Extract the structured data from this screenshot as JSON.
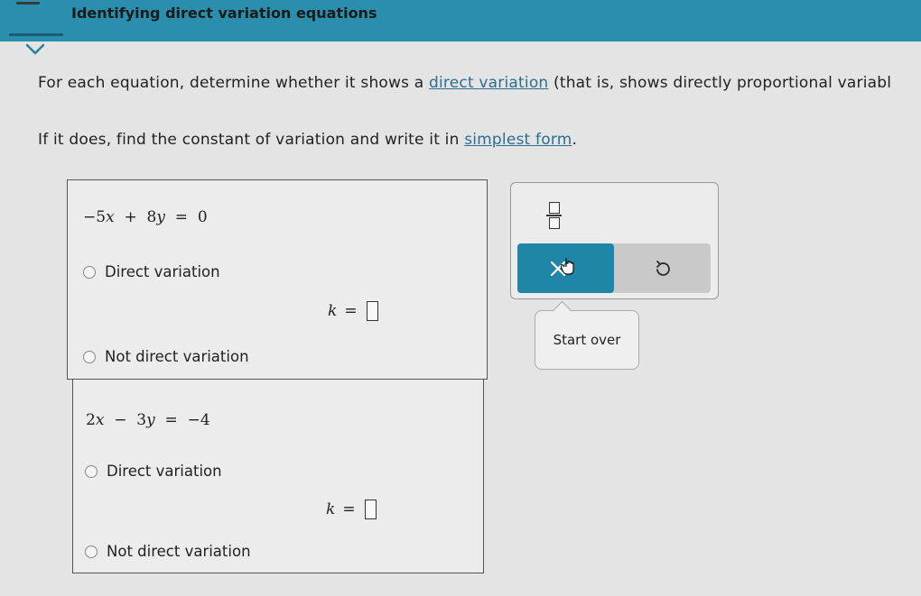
{
  "header": {
    "title": "Identifying direct variation equations"
  },
  "instructions": {
    "line1_before": "For each equation, determine whether it shows a ",
    "line1_link": "direct variation",
    "line1_after": " (that is, shows directly proportional variabl",
    "line2_before": "If it does, find the constant of variation and write it in ",
    "line2_link": "simplest form",
    "line2_after": "."
  },
  "questions": [
    {
      "equation": "−5x + 8y = 0",
      "option_direct": "Direct variation",
      "k_label": "k",
      "k_equals": "=",
      "option_not_direct": "Not direct variation"
    },
    {
      "equation": "2x − 3y = −4",
      "option_direct": "Direct variation",
      "k_label": "k",
      "k_equals": "=",
      "option_not_direct": "Not direct variation"
    }
  ],
  "toolbar": {
    "fraction_icon": "fraction-icon",
    "clear_icon": "x-icon",
    "undo_icon": "undo-icon"
  },
  "tooltip": {
    "text": "Start over"
  },
  "colors": {
    "header_bg": "#2a8fad",
    "accent_button": "#1f86a8",
    "link": "#2b6e92"
  }
}
